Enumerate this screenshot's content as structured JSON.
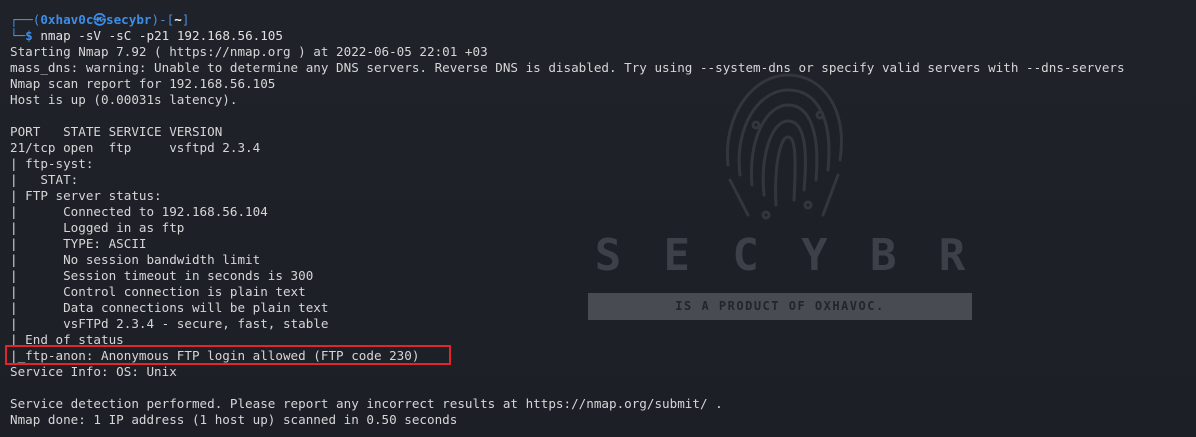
{
  "watermark": {
    "word_letters": [
      "S",
      "E",
      "C",
      "Y",
      "B",
      "R"
    ],
    "tagline": "IS A PRODUCT OF OXHAVOC."
  },
  "prompt": {
    "frame_top": "┌──(",
    "user": "0xhav0c",
    "at_symbol": "㉿",
    "host": "secybr",
    "frame_mid": ")-[",
    "path": "~",
    "frame_end": "]",
    "frame_bottom": "└─",
    "dollar": "$",
    "command": " nmap -sV -sC -p21 192.168.56.105"
  },
  "output_lines": [
    "Starting Nmap 7.92 ( https://nmap.org ) at 2022-06-05 22:01 +03",
    "mass_dns: warning: Unable to determine any DNS servers. Reverse DNS is disabled. Try using --system-dns or specify valid servers with --dns-servers",
    "Nmap scan report for 192.168.56.105",
    "Host is up (0.00031s latency).",
    "",
    "PORT   STATE SERVICE VERSION",
    "21/tcp open  ftp     vsftpd 2.3.4",
    "| ftp-syst:",
    "|   STAT:",
    "| FTP server status:",
    "|      Connected to 192.168.56.104",
    "|      Logged in as ftp",
    "|      TYPE: ASCII",
    "|      No session bandwidth limit",
    "|      Session timeout in seconds is 300",
    "|      Control connection is plain text",
    "|      Data connections will be plain text",
    "|      vsFTPd 2.3.4 - secure, fast, stable",
    "| End of status",
    "|_ftp-anon: Anonymous FTP login allowed (FTP code 230)",
    "Service Info: OS: Unix",
    "",
    "Service detection performed. Please report any incorrect results at https://nmap.org/submit/ .",
    "Nmap done: 1 IP address (1 host up) scanned in 0.50 seconds"
  ],
  "colors": {
    "background": "#1f2129",
    "text": "#d6d6d6",
    "prompt_blue": "#3b8eea",
    "highlight_red": "#e0262a"
  }
}
